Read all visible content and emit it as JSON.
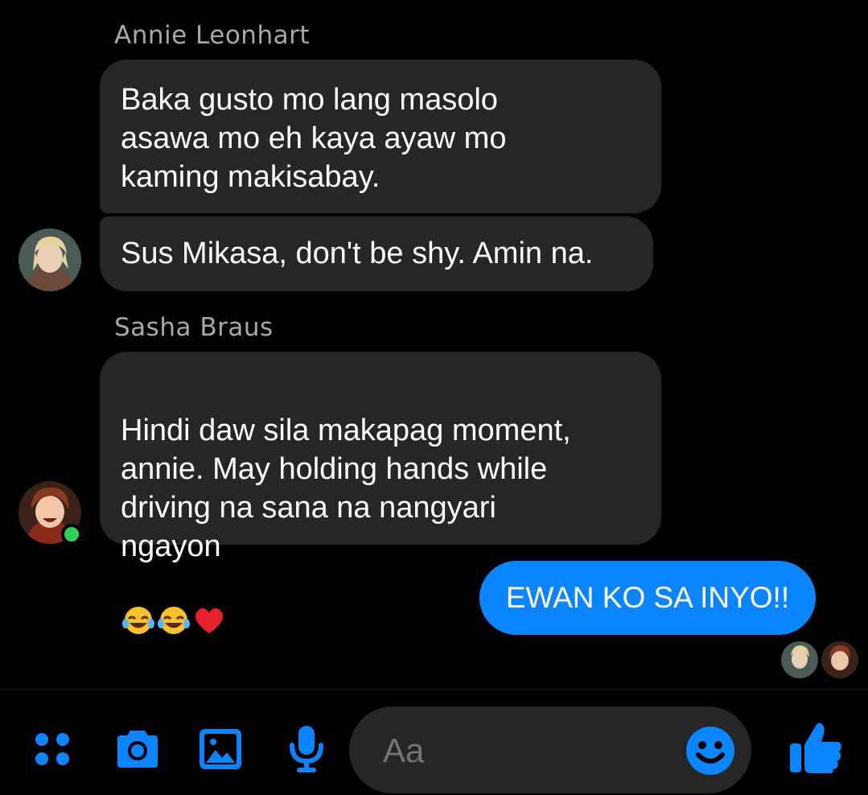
{
  "messages": {
    "annie": {
      "name": "Annie Leonhart",
      "msg1": "Baka gusto mo lang masolo\nasawa mo eh kaya ayaw mo\nkaming makisabay.",
      "msg2": "Sus Mikasa, don't be shy. Amin na."
    },
    "sasha": {
      "name": "Sasha Braus",
      "msg1": "Hindi daw sila makapag moment,\nannie. May holding hands while\ndriving na sana na nangyari\nngayon",
      "emojis": [
        "rolling-on-floor-laughing",
        "rolling-on-floor-laughing",
        "red-heart"
      ]
    },
    "outgoing": {
      "text": "EWAN KO SA INYO!!"
    }
  },
  "composer": {
    "placeholder": "Aa"
  },
  "icons": {
    "accent": "#0a84ff",
    "online": "#31d158"
  }
}
